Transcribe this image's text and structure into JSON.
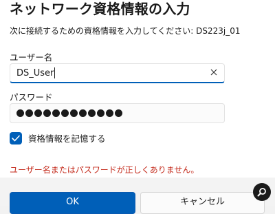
{
  "dialog": {
    "title": "ネットワーク資格情報の入力",
    "description": "次に接続するための資格情報を入力してください: DS223j_01"
  },
  "username": {
    "label": "ユーザー名",
    "value": "DS_User",
    "clear_icon": "close-icon"
  },
  "password": {
    "label": "パスワード",
    "masked_length": 12
  },
  "remember": {
    "label": "資格情報を記憶する",
    "checked": true
  },
  "error": {
    "message": "ユーザー名またはパスワードが正しくありません。"
  },
  "buttons": {
    "ok_label": "OK",
    "cancel_label": "キャンセル"
  },
  "colors": {
    "accent": "#005fb8",
    "error": "#c42b1c"
  },
  "overlay": {
    "icon": "search-icon"
  }
}
